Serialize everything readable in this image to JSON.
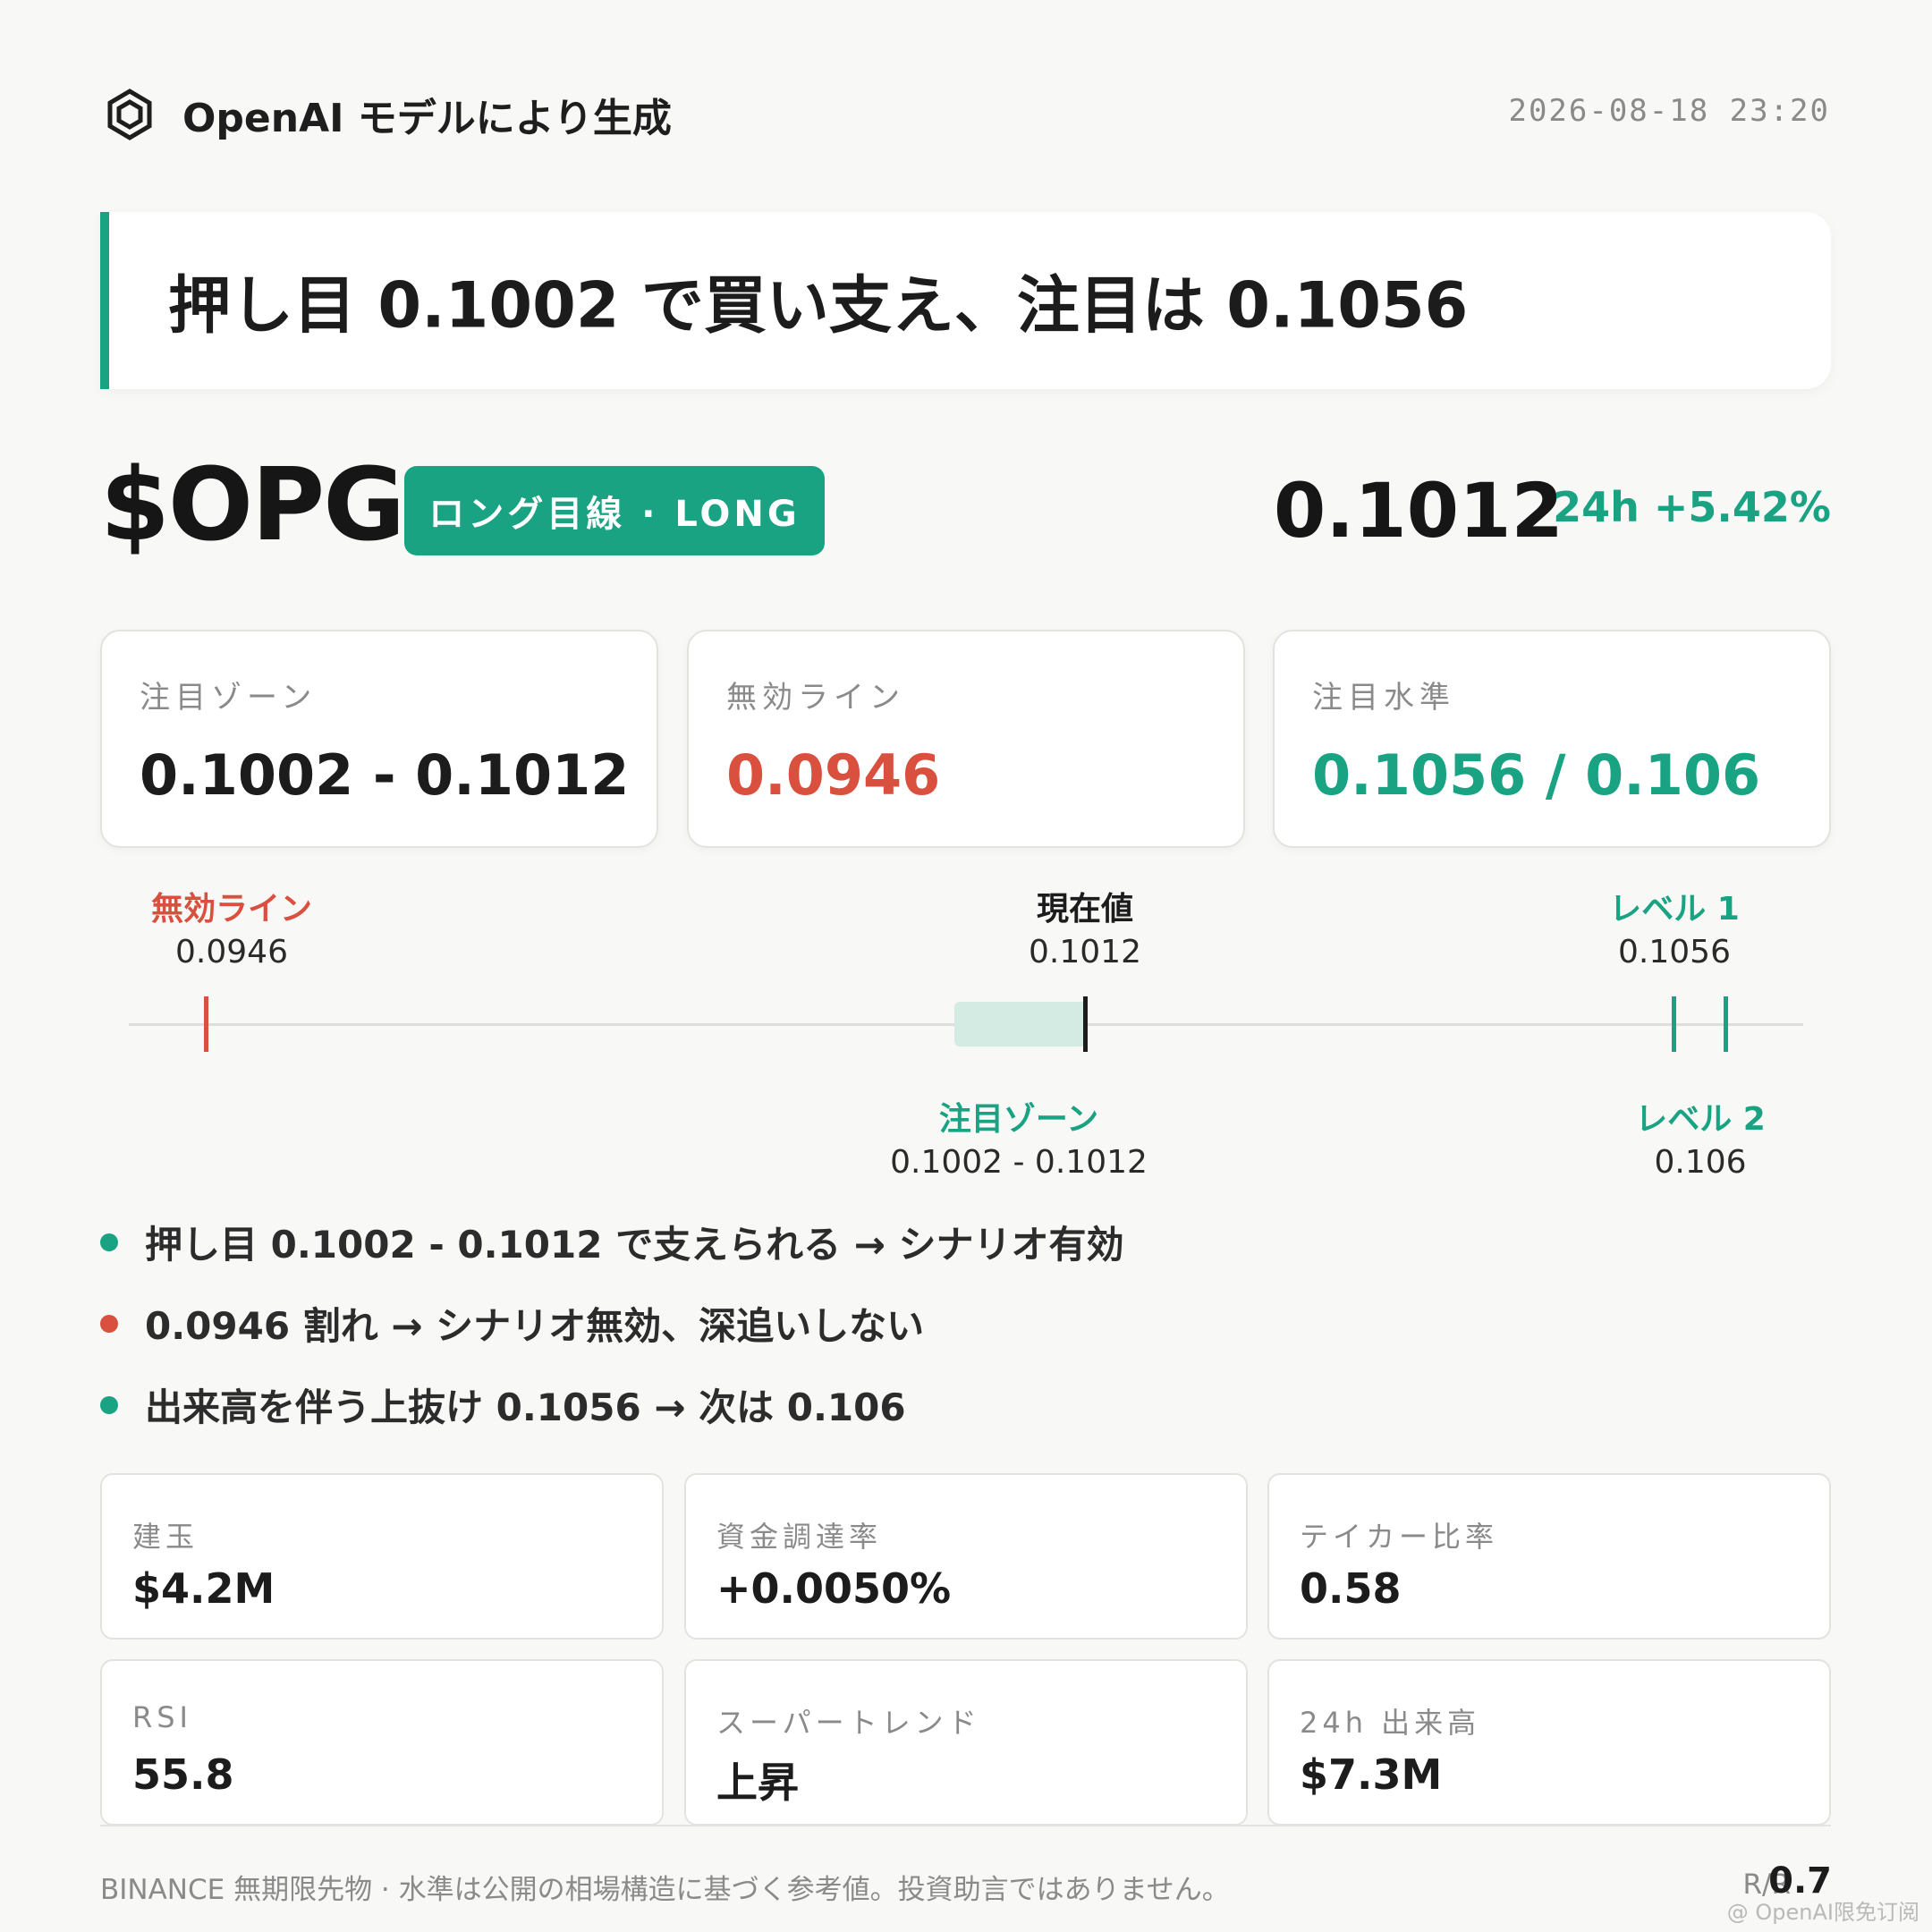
{
  "header": {
    "brand_icon": "openai-hexagon-icon",
    "brand_text": "OpenAI モデルにより生成",
    "timestamp": "2026-08-18 23:20"
  },
  "headline": "押し目 0.1002 で買い支え、注目は 0.1056",
  "ticker": {
    "symbol": "$OPG",
    "direction_badge": "ロング目線 · LONG",
    "price": "0.1012",
    "change_24h": "24h +5.42%"
  },
  "level_cards": [
    {
      "label": "注目ゾーン",
      "value": "0.1002 - 0.1012",
      "color": "#1c1c1c"
    },
    {
      "label": "無効ライン",
      "value": "0.0946",
      "color": "#d9503f"
    },
    {
      "label": "注目水準",
      "value": "0.1056 / 0.106",
      "color": "#1aa383"
    }
  ],
  "price_map": {
    "invalidation": {
      "label": "無効ライン",
      "value": "0.0946"
    },
    "current": {
      "label": "現在値",
      "value": "0.1012"
    },
    "level1": {
      "label": "レベル 1",
      "value": "0.1056"
    },
    "zone": {
      "label": "注目ゾーン",
      "value": "0.1002 - 0.1012"
    },
    "level2": {
      "label": "レベル 2",
      "value": "0.106"
    }
  },
  "bullets": [
    {
      "text": "押し目 0.1002 - 0.1012 で支えられる → シナリオ有効",
      "color": "#1aa383"
    },
    {
      "text": "0.0946 割れ → シナリオ無効、深追いしない",
      "color": "#d9503f"
    },
    {
      "text": "出来高を伴う上抜け 0.1056 → 次は 0.106",
      "color": "#1aa383"
    }
  ],
  "stats": [
    {
      "label": "建玉",
      "value": "$4.2M"
    },
    {
      "label": "資金調達率",
      "value": "+0.0050%"
    },
    {
      "label": "テイカー比率",
      "value": "0.58"
    },
    {
      "label": "RSI",
      "value": "55.8"
    },
    {
      "label": "スーパートレンド",
      "value": "上昇"
    },
    {
      "label": "24h 出来高",
      "value": "$7.3M"
    }
  ],
  "footer": {
    "disclaimer": "BINANCE 無期限先物 · 水準は公開の相場構造に基づく参考値。投資助言ではありません。",
    "rr_label": "R/R",
    "rr_value": "0.7",
    "watermark": "@ OpenAI限免订阅"
  },
  "colors": {
    "accent_green": "#1aa383",
    "invalid_red": "#d9503f",
    "zone_fill": "#d3ebe3"
  }
}
